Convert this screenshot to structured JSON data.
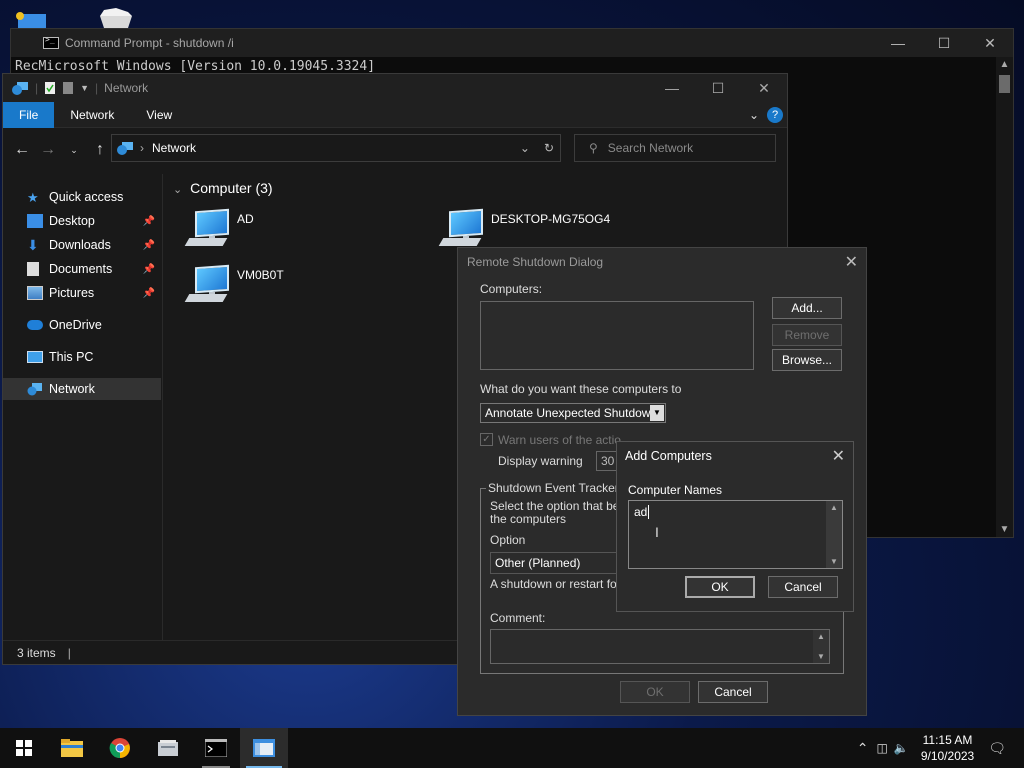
{
  "cmd": {
    "title": "Command Prompt - shutdown  /i",
    "line1_prefix": "Rec",
    "line1": "Microsoft Windows [Version 10.0.19045.3324]"
  },
  "explorer": {
    "title": "Network",
    "tabs": [
      "File",
      "Network",
      "View"
    ],
    "breadcrumb": "Network",
    "search_placeholder": "Search Network",
    "sidebar": [
      {
        "label": "Quick access",
        "icon": "star-icon"
      },
      {
        "label": "Desktop",
        "icon": "desktop-folder-icon",
        "pinned": true
      },
      {
        "label": "Downloads",
        "icon": "downloads-icon",
        "pinned": true
      },
      {
        "label": "Documents",
        "icon": "documents-icon",
        "pinned": true
      },
      {
        "label": "Pictures",
        "icon": "pictures-icon",
        "pinned": true
      },
      {
        "label": "OneDrive",
        "icon": "cloud-icon"
      },
      {
        "label": "This PC",
        "icon": "pc-icon"
      },
      {
        "label": "Network",
        "icon": "network-icon",
        "selected": true
      }
    ],
    "group_header": "Computer (3)",
    "computers": [
      "AD",
      "DESKTOP-MG75OG4",
      "VM0B0T"
    ],
    "status": "3 items"
  },
  "shutdown_dialog": {
    "title": "Remote Shutdown Dialog",
    "computers_label": "Computers:",
    "add_button": "Add...",
    "remove_button": "Remove",
    "browse_button": "Browse...",
    "action_question": "What do you want these computers to",
    "action_value": "Annotate Unexpected Shutdow",
    "warn_label": "Warn users of the actio",
    "display_warning_label": "Display warning",
    "display_warning_value": "30",
    "tracker_group": "Shutdown Event Tracker",
    "tracker_text_1": "Select the option that be",
    "tracker_text_2": "the computers",
    "option_label": "Option",
    "option_value": "Other (Planned)",
    "option_desc": "A shutdown or restart fo",
    "comment_label": "Comment:",
    "ok_button": "OK",
    "cancel_button": "Cancel"
  },
  "add_computers": {
    "title": "Add Computers",
    "names_label": "Computer Names",
    "names_value": "ad",
    "ok_button": "OK",
    "cancel_button": "Cancel"
  },
  "taskbar": {
    "apps": [
      "file-explorer",
      "chrome",
      "server-manager",
      "command-prompt",
      "network-explorer"
    ],
    "time": "11:15 AM",
    "date": "9/10/2023"
  },
  "colors": {
    "accent": "#1979ca",
    "dialog_bg": "#2b2b2b",
    "explorer_bg": "#191919"
  }
}
